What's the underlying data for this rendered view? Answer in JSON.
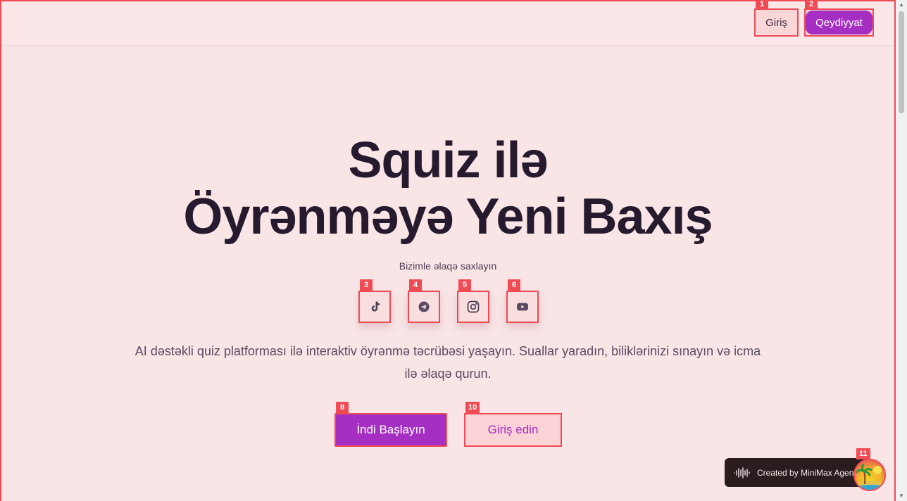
{
  "header": {
    "login_label": "Giriş",
    "register_label": "Qeydiyyat"
  },
  "hero": {
    "title_line1": "Squiz ilə",
    "title_line2": "Öyrənməyə Yeni Baxış",
    "contact_label": "Bizimle əlaqə saxlayın",
    "description": "AI dəstəkli quiz platforması ilə interaktiv öyrənmə təcrübəsi yaşayın. Suallar yaradın, biliklərinizi sınayın və icma ilə əlaqə qurun.",
    "start_label": "İndi Başlayın",
    "login_label": "Giriş edin"
  },
  "social": [
    {
      "icon": "tiktok-icon"
    },
    {
      "icon": "telegram-icon"
    },
    {
      "icon": "instagram-icon"
    },
    {
      "icon": "youtube-icon"
    }
  ],
  "badges": [
    "1",
    "2",
    "3",
    "4",
    "5",
    "6",
    "8",
    "10",
    "11"
  ],
  "footer_widget": {
    "text": "Created by MiniMax Agent",
    "icon": "waveform-icon"
  },
  "colors": {
    "background": "#f9e5e6",
    "accent": "#a62fc3",
    "annotation": "#ef4b55",
    "text_dark": "#261a2e"
  }
}
